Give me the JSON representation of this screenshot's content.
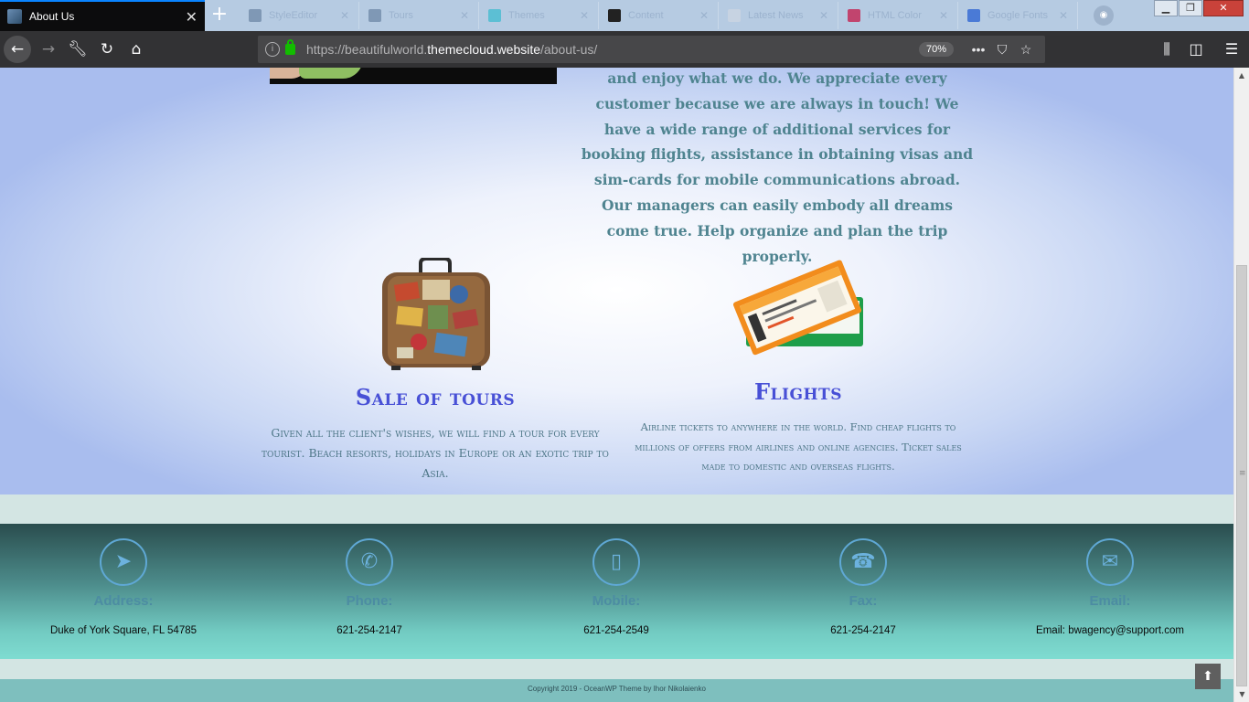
{
  "browser": {
    "active_tab": {
      "title": "About Us"
    },
    "background_tabs": [
      {
        "label": "StyleEditor"
      },
      {
        "label": "Tours"
      },
      {
        "label": "Themes"
      },
      {
        "label": "Content"
      },
      {
        "label": "Latest News"
      },
      {
        "label": "HTML Color"
      },
      {
        "label": "Google Fonts"
      }
    ],
    "url": {
      "prefix": "https://beautifulworld.",
      "host": "themecloud.website",
      "path": "/about-us/"
    },
    "zoom": "70%"
  },
  "page": {
    "about_paragraph": "and enjoy what we do. We appreciate every customer because we are always in touch! We have a wide range of additional services for booking flights, assistance in obtaining visas and sim-cards for mobile communications abroad. Our managers can easily embody all dreams come true. Help organize and plan the trip properly.",
    "features": [
      {
        "title": "Sale of tours",
        "description": "Given all the client's wishes, we will find a tour for every tourist. Beach resorts, holidays in Europe or an exotic trip to Asia."
      },
      {
        "title": "Flights",
        "description": "Airline tickets to anywhere in the world. Find cheap flights to millions of offers from airlines and online agencies. Ticket sales made to domestic and overseas flights."
      }
    ]
  },
  "footer": {
    "contacts": [
      {
        "icon": "location-arrow-icon",
        "label": "Address:",
        "value": "Duke of York Square, FL 54785"
      },
      {
        "icon": "phone-icon",
        "label": "Phone:",
        "value": "621-254-2147"
      },
      {
        "icon": "mobile-icon",
        "label": "Mobile:",
        "value": "621-254-2549"
      },
      {
        "icon": "fax-icon",
        "label": "Fax:",
        "value": "621-254-2147"
      },
      {
        "icon": "envelope-icon",
        "label": "Email:",
        "value": "Email: bwagency@support.com"
      }
    ],
    "copyright": "Copyright 2019 - OceanWP Theme by Ihor Nikolaienko",
    "accent_color": "#5fa8d5"
  }
}
